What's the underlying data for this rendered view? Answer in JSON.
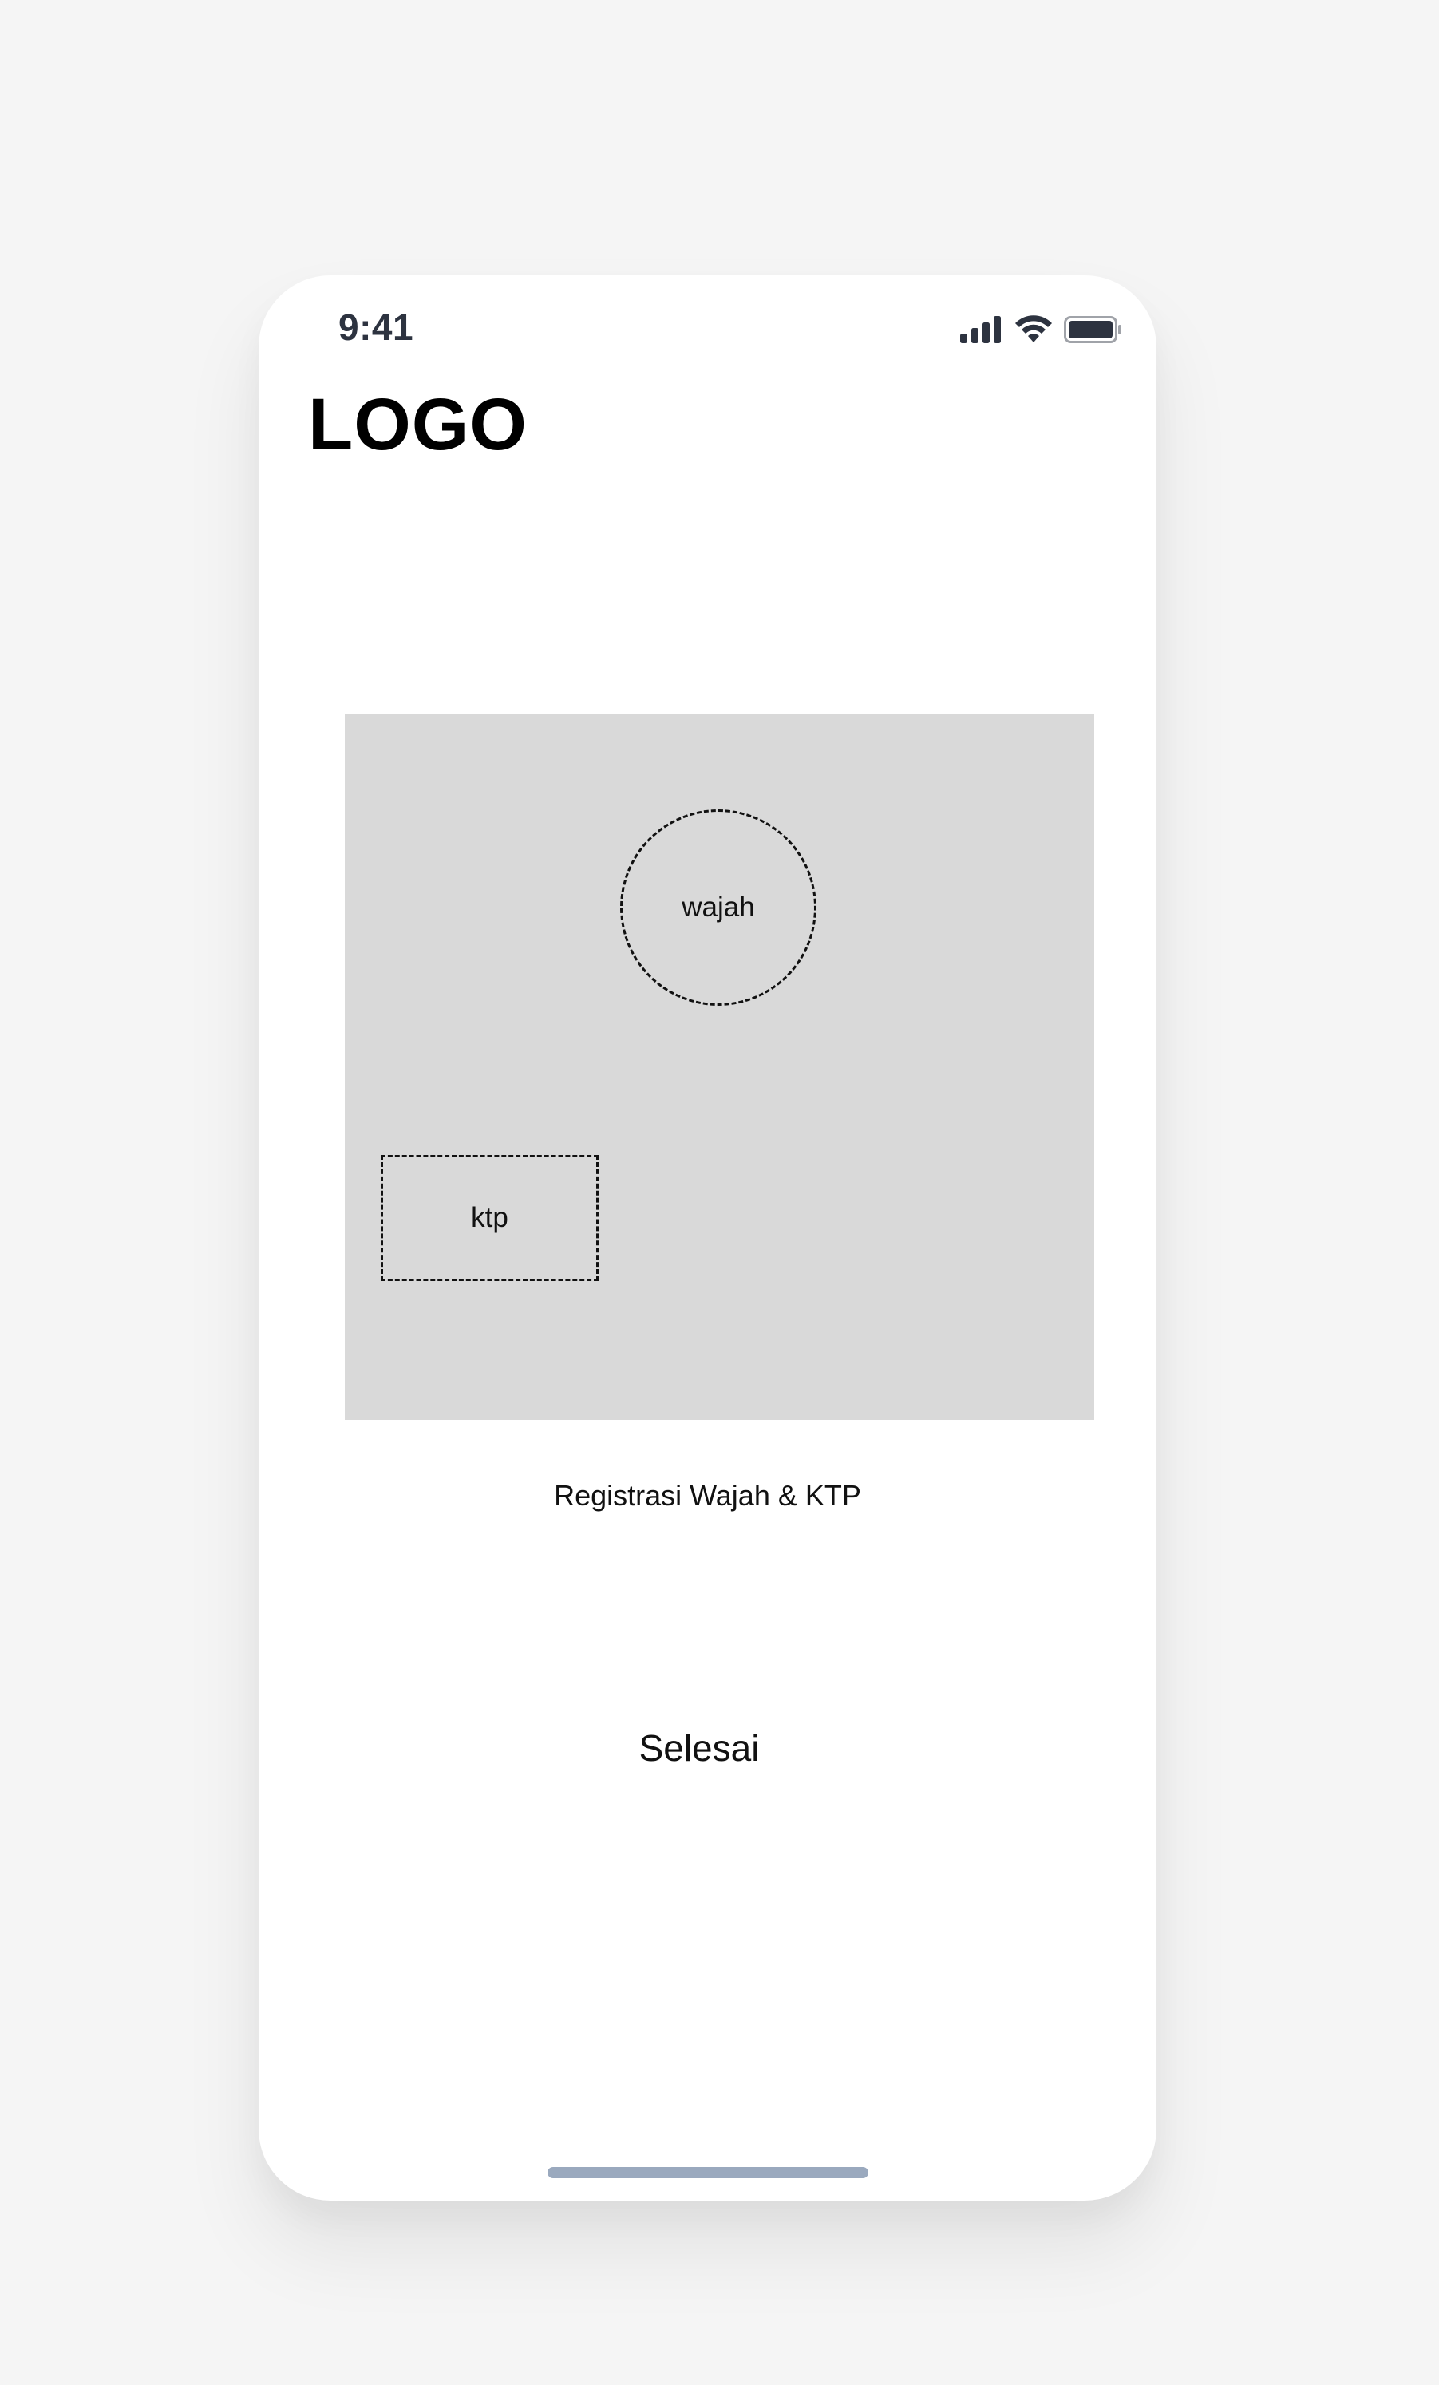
{
  "status_bar": {
    "time": "9:41",
    "icons": [
      "signal-icon",
      "wifi-icon",
      "battery-icon"
    ]
  },
  "header": {
    "logo": "LOGO"
  },
  "camera": {
    "face_label": "wajah",
    "ktp_label": "ktp"
  },
  "caption": "Registrasi Wajah & KTP",
  "actions": {
    "done_label": "Selesai"
  },
  "colors": {
    "page_background": "#f5f5f5",
    "screen_background": "#ffffff",
    "camera_placeholder": "#d9d9d9",
    "status_icons": "#2d3340",
    "home_indicator": "#9aa9be"
  }
}
